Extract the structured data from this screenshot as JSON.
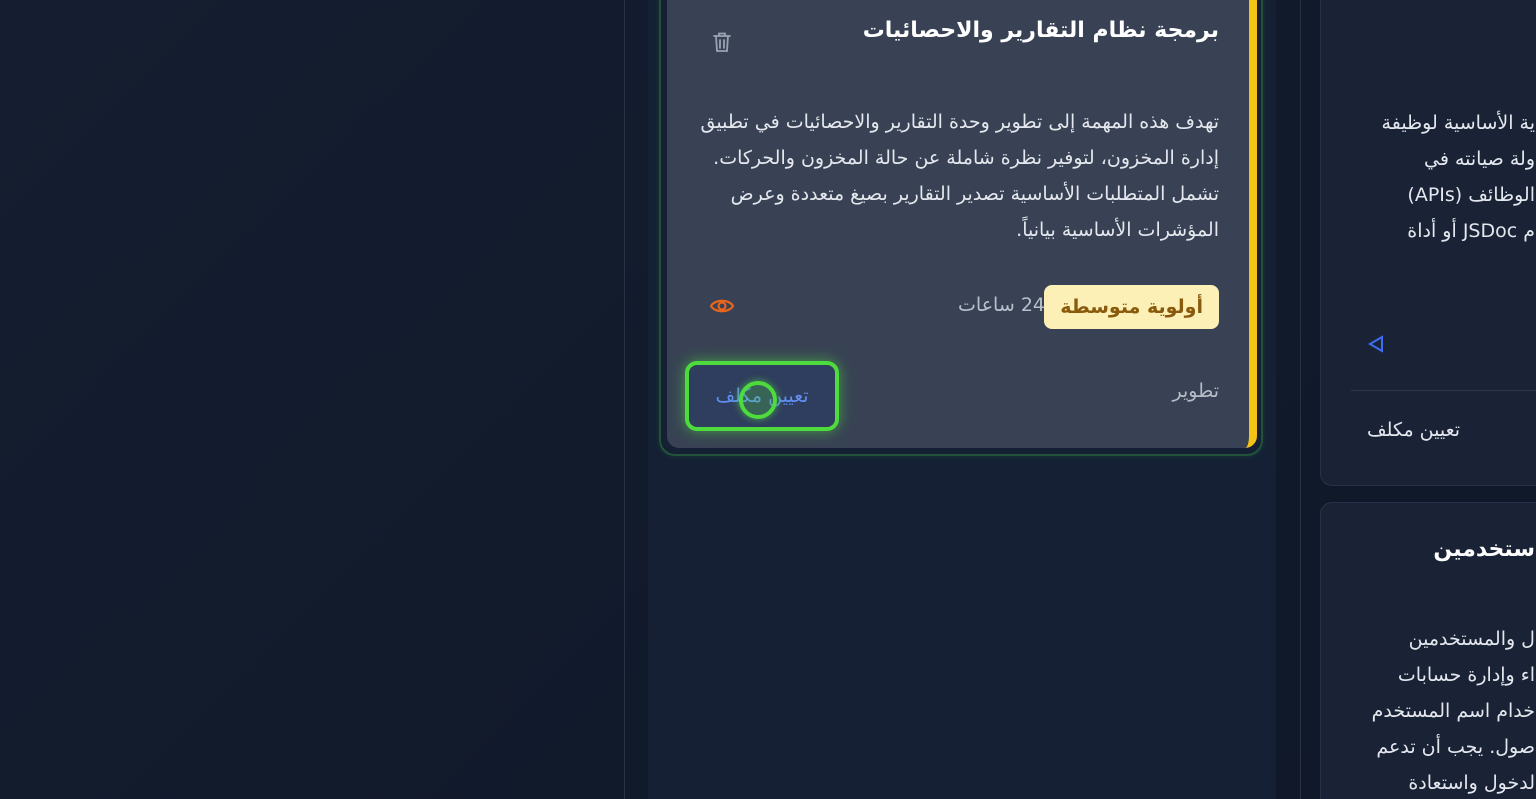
{
  "card": {
    "title": "برمجة نظام التقارير والاحصائيات",
    "description": "تهدف هذه المهمة إلى تطوير وحدة التقارير والاحصائيات في تطبيق إدارة المخزون، لتوفير نظرة شاملة عن حالة المخزون والحركات. تشمل المتطلبات الأساسية تصدير التقارير بصيغ متعددة وعرض المؤشرات الأساسية بيانياً.",
    "priority": "أولوية متوسطة",
    "hours": "24 ساعات",
    "category": "تطوير",
    "assign_label": "تعيين مكلف",
    "accent_color": "#f3c316"
  },
  "right_card_1": {
    "lines": [
      "ية الأساسية لوظيفة",
      "ولة صيانته في",
      "الوظائف (APIs)",
      "م JSDoc أو أداة"
    ],
    "assign_label": "تعيين مكلف"
  },
  "right_card_2": {
    "title": "ستخدمين",
    "lines": [
      "ل والمستخدمين",
      "اء وإدارة حسابات",
      "خدام اسم المستخدم",
      "صول. يجب أن تدعم",
      "لدخول واستعادة"
    ]
  },
  "icons": {
    "trash": "trash-icon",
    "eye": "eye-icon",
    "play": "play-icon"
  },
  "colors": {
    "priority_bg": "#fdf0b6",
    "priority_text": "#8a5a0c",
    "eye": "#e8651c",
    "highlight": "#4edb3e",
    "link_blue": "#5f8ff0"
  }
}
